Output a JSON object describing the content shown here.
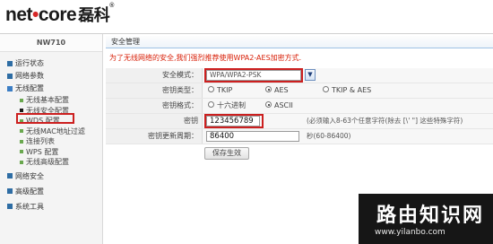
{
  "header": {
    "brand_net": "net",
    "brand_dot": "•",
    "brand_core": "core",
    "brand_cn": "磊科",
    "trademark": "®"
  },
  "sidebar": {
    "model": "NW710",
    "items": [
      {
        "label": "运行状态",
        "type": "top"
      },
      {
        "label": "网络参数",
        "type": "top"
      },
      {
        "label": "无线配置",
        "type": "top-open"
      },
      {
        "label": "无线基本配置",
        "type": "sub"
      },
      {
        "label": "无线安全配置",
        "type": "sub-active"
      },
      {
        "label": "WDS 配置",
        "type": "sub"
      },
      {
        "label": "无线MAC地址过滤",
        "type": "sub"
      },
      {
        "label": "连接列表",
        "type": "sub"
      },
      {
        "label": "WPS 配置",
        "type": "sub"
      },
      {
        "label": "无线高级配置",
        "type": "sub"
      },
      {
        "label": "网络安全",
        "type": "top"
      },
      {
        "label": "高级配置",
        "type": "top"
      },
      {
        "label": "系统工具",
        "type": "top"
      }
    ]
  },
  "main": {
    "panel_title": "安全管理",
    "notice": "为了无线网络的安全,我们强烈推荐使用WPA2-AES加密方式.",
    "security_mode": {
      "label": "安全模式：",
      "value": "WPA/WPA2-PSK"
    },
    "cipher_type": {
      "label": "密钥类型：",
      "options": [
        "TKIP",
        "AES",
        "TKIP & AES"
      ],
      "selected": "AES"
    },
    "key_format": {
      "label": "密钥格式：",
      "options": [
        "十六进制",
        "ASCII"
      ],
      "selected": "ASCII"
    },
    "key": {
      "label": "密钥",
      "value": "123456789",
      "hint": "(必须输入8-63个任意字符(除去 [\\' \"] 这些特殊字符)"
    },
    "key_renewal": {
      "label": "密钥更新周期：",
      "value": "86400",
      "hint": "秒(60-86400)"
    },
    "save_label": "保存生效"
  },
  "watermark": {
    "cn": "路由知识网",
    "url": "www.yilanbo.com"
  },
  "colors": {
    "highlight_red": "#cc1f1f",
    "notice_red": "#d81e06",
    "brand_dot_red": "#d62828",
    "menu_blue": "#2e6da4"
  }
}
